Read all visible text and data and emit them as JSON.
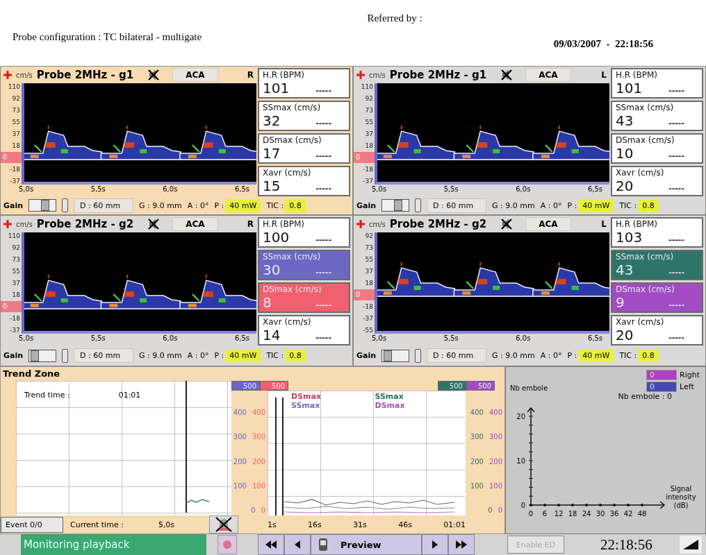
{
  "header": {
    "referred_by": "Referred by :",
    "probe_configuration": "Probe configuration : TC bilateral - multigate",
    "date_time": "09/03/2007  -  22:18:56"
  },
  "probes": [
    {
      "selected": true,
      "unit": "cm/s",
      "title": "Probe 2MHz - g1",
      "vessel": "ACA",
      "side": "R",
      "y_ticks": [
        {
          "label": "110",
          "kind": "tick"
        },
        {
          "label": "92",
          "kind": "tick"
        },
        {
          "label": "73",
          "kind": "tick"
        },
        {
          "label": "55",
          "kind": "tick"
        },
        {
          "label": "37",
          "kind": "tick"
        },
        {
          "label": "18",
          "kind": "tick"
        },
        {
          "label": "0",
          "kind": "baseline"
        },
        {
          "label": "-18",
          "kind": "tick"
        },
        {
          "label": "-37",
          "kind": "tick"
        }
      ],
      "x_ticks": [
        "5,0s",
        "5,5s",
        "6,0s",
        "6,5s"
      ],
      "metrics": [
        {
          "label": "H.R (BPM)",
          "value": "101",
          "trend": "-----",
          "color": "#ffffff"
        },
        {
          "label": "SSmax (cm/s)",
          "value": "32",
          "trend": "-----",
          "color": "#ffffff"
        },
        {
          "label": "DSmax (cm/s)",
          "value": "17",
          "trend": "-----",
          "color": "#ffffff"
        },
        {
          "label": "Xavr (cm/s)",
          "value": "15",
          "trend": "-----",
          "color": "#ffffff"
        }
      ],
      "gain": {
        "label": "Gain",
        "level": 0.6
      },
      "depth": "D : 60 mm",
      "gate": "G : 9.0 mm",
      "angle": "A : 0°",
      "power_label": "P :",
      "power": "40 mW",
      "tic_label": "TIC :",
      "tic": "0.8"
    },
    {
      "selected": false,
      "unit": "cm/s",
      "title": "Probe 2MHz - g1",
      "vessel": "ACA",
      "side": "L",
      "y_ticks": [
        {
          "label": "110",
          "kind": "tick"
        },
        {
          "label": "92",
          "kind": "tick"
        },
        {
          "label": "73",
          "kind": "tick"
        },
        {
          "label": "55",
          "kind": "tick"
        },
        {
          "label": "37",
          "kind": "tick"
        },
        {
          "label": "18",
          "kind": "tick"
        },
        {
          "label": "0",
          "kind": "baseline"
        },
        {
          "label": "-18",
          "kind": "tick"
        },
        {
          "label": "-37",
          "kind": "tick"
        }
      ],
      "x_ticks": [
        "5,0s",
        "5,5s",
        "6,0s",
        "6,5s"
      ],
      "metrics": [
        {
          "label": "H.R (BPM)",
          "value": "101",
          "trend": "-----",
          "color": "#ffffff"
        },
        {
          "label": "SSmax (cm/s)",
          "value": "43",
          "trend": "-----",
          "color": "#ffffff"
        },
        {
          "label": "DSmax (cm/s)",
          "value": "10",
          "trend": "-----",
          "color": "#ffffff"
        },
        {
          "label": "Xavr (cm/s)",
          "value": "20",
          "trend": "-----",
          "color": "#ffffff"
        }
      ],
      "gain": {
        "label": "Gain",
        "level": 0.6
      },
      "depth": "D : 60 mm",
      "gate": "G : 9.0 mm",
      "angle": "A : 0°",
      "power_label": "P :",
      "power": "40 mW",
      "tic_label": "TIC :",
      "tic": "0.8"
    },
    {
      "selected": false,
      "unit": "cm/s",
      "title": "Probe 2MHz - g2",
      "vessel": "ACA",
      "side": "R",
      "y_ticks": [
        {
          "label": "110",
          "kind": "tick"
        },
        {
          "label": "92",
          "kind": "tick"
        },
        {
          "label": "73",
          "kind": "tick"
        },
        {
          "label": "55",
          "kind": "tick"
        },
        {
          "label": "37",
          "kind": "tick"
        },
        {
          "label": "18",
          "kind": "tick"
        },
        {
          "label": "0",
          "kind": "baseline"
        },
        {
          "label": "-18",
          "kind": "tick"
        },
        {
          "label": "-37",
          "kind": "tick"
        }
      ],
      "x_ticks": [
        "5,0s",
        "5,5s",
        "6,0s",
        "6,5s"
      ],
      "metrics": [
        {
          "label": "H.R (BPM)",
          "value": "100",
          "trend": "-----",
          "color": "#ffffff"
        },
        {
          "label": "SSmax (cm/s)",
          "value": "30",
          "trend": "-----",
          "color": "#6c68c4"
        },
        {
          "label": "DSmax (cm/s)",
          "value": "8",
          "trend": "-----",
          "color": "#f0606e"
        },
        {
          "label": "Xavr (cm/s)",
          "value": "14",
          "trend": "-----",
          "color": "#ffffff"
        }
      ],
      "gain": {
        "label": "Gain",
        "level": 0.2
      },
      "depth": "D : 60 mm",
      "gate": "G : 9.0 mm",
      "angle": "A : 0°",
      "power_label": "P :",
      "power": "40 mW",
      "tic_label": "TIC :",
      "tic": "0.8"
    },
    {
      "selected": false,
      "unit": "cm/s",
      "title": "Probe 2MHz - g2",
      "vessel": "ACA",
      "side": "L",
      "y_ticks": [
        {
          "label": "92",
          "kind": "tick"
        },
        {
          "label": "73",
          "kind": "tick"
        },
        {
          "label": "55",
          "kind": "tick"
        },
        {
          "label": "37",
          "kind": "tick"
        },
        {
          "label": "18",
          "kind": "tick"
        },
        {
          "label": "0",
          "kind": "baseline"
        },
        {
          "label": "-18",
          "kind": "tick"
        },
        {
          "label": "-37",
          "kind": "tick"
        },
        {
          "label": "-55",
          "kind": "tick"
        }
      ],
      "x_ticks": [
        "5,0s",
        "5,5s",
        "6,0s",
        "6,5s"
      ],
      "metrics": [
        {
          "label": "H.R (BPM)",
          "value": "103",
          "trend": "-----",
          "color": "#ffffff"
        },
        {
          "label": "SSmax (cm/s)",
          "value": "43",
          "trend": "-----",
          "color": "#2e7468"
        },
        {
          "label": "DSmax (cm/s)",
          "value": "9",
          "trend": "-----",
          "color": "#a24cc4"
        },
        {
          "label": "Xavr (cm/s)",
          "value": "20",
          "trend": "-----",
          "color": "#ffffff"
        }
      ],
      "gain": {
        "label": "Gain",
        "level": 0.2
      },
      "depth": "D : 60 mm",
      "gate": "G : 9.0 mm",
      "angle": "A : 0°",
      "power_label": "P :",
      "power": "40 mW",
      "tic_label": "TIC :",
      "tic": "0.8"
    }
  ],
  "trend": {
    "title": "Trend Zone",
    "trend_time_label": "Trend time :",
    "trend_time": "01:01",
    "event": "Event 0/0",
    "current_time_label": "Current time :",
    "current_time": "5,0s",
    "scales": [
      {
        "badge": "500",
        "color": "#6c68c4",
        "ticks": [
          "400",
          "300",
          "200",
          "100",
          "0"
        ]
      },
      {
        "badge": "500",
        "color": "#f0606e",
        "ticks": [
          "400",
          "300",
          "200",
          "100",
          "0"
        ]
      },
      {
        "badge": "500",
        "color": "#2e7468",
        "ticks": [
          "400",
          "300",
          "200",
          "100",
          "0"
        ]
      },
      {
        "badge": "500",
        "color": "#a24cc4",
        "ticks": [
          "400",
          "300",
          "200",
          "100",
          "0"
        ]
      }
    ],
    "legend": [
      {
        "name": "DSmax",
        "color": "#c0405a"
      },
      {
        "name": "SSmax",
        "color": "#7070b0"
      },
      {
        "name": "SSmax",
        "color": "#2a6a60"
      },
      {
        "name": "DSmax",
        "color": "#a050c0"
      }
    ],
    "x_ticks": [
      "1s",
      "16s",
      "31s",
      "46s",
      "01:01"
    ]
  },
  "emboli": {
    "legend": [
      {
        "count": "0",
        "label": "Right",
        "color": "#b040c0"
      },
      {
        "count": "0",
        "label": "Left",
        "color": "#4848b8"
      }
    ],
    "summary": "Nb embole : 0",
    "y_label": "Nb embole",
    "y_ticks": [
      "20",
      "10",
      "0"
    ],
    "x_ticks": [
      "0",
      "6",
      "12",
      "18",
      "24",
      "30",
      "36",
      "42",
      "48"
    ],
    "x_label": [
      "Signal",
      "intensity",
      "(dB)"
    ]
  },
  "bottom_bar": {
    "status": "Monitoring playback",
    "preview": "Preview",
    "enable": {
      "label": "Enable ED",
      "disabled": true
    },
    "clock": "22:18:56"
  }
}
